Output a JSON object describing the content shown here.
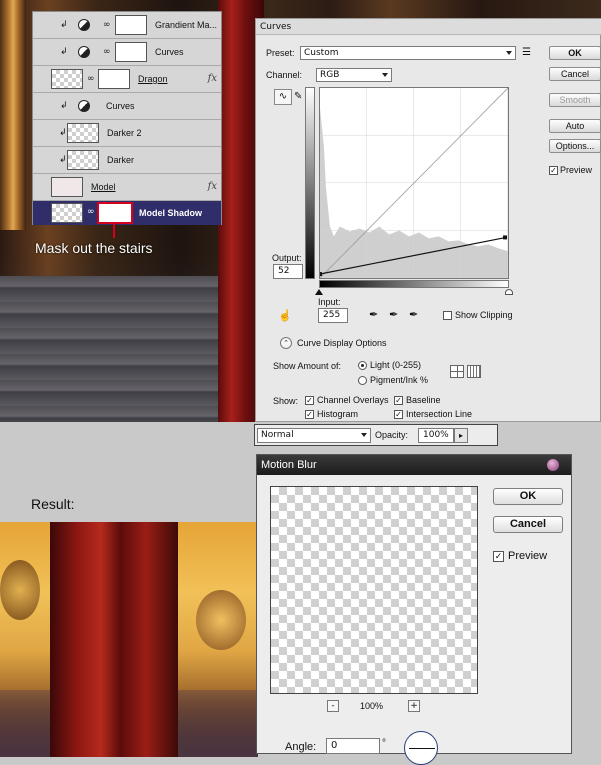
{
  "layers": [
    {
      "name": "Grandient Ma...",
      "kind": "adjustment",
      "selected": false,
      "fx": false
    },
    {
      "name": "Curves",
      "kind": "adjustment",
      "selected": false,
      "fx": false
    },
    {
      "name": "Dragon",
      "kind": "masked",
      "selected": false,
      "fx": true
    },
    {
      "name": "Curves",
      "kind": "adjustment-nomask",
      "selected": false,
      "fx": false
    },
    {
      "name": "Darker 2",
      "kind": "clip-pixel",
      "selected": false,
      "fx": false
    },
    {
      "name": "Darker",
      "kind": "clip-pixel",
      "selected": false,
      "fx": false
    },
    {
      "name": "Model",
      "kind": "pixel",
      "selected": false,
      "fx": true
    },
    {
      "name": "Model Shadow",
      "kind": "masked",
      "selected": true,
      "fx": false
    }
  ],
  "fx_glyph": "fx",
  "caption_mask": "Mask out the stairs",
  "caption_result": "Result:",
  "curves": {
    "title": "Curves",
    "preset_label": "Preset:",
    "preset_value": "Custom",
    "channel_label": "Channel:",
    "channel_value": "RGB",
    "output_label": "Output:",
    "output_value": "52",
    "input_label": "Input:",
    "input_value": "255",
    "show_clipping": "Show Clipping",
    "display_options": "Curve Display Options",
    "show_amount_label": "Show Amount of:",
    "light_option": "Light  (0-255)",
    "pigment_option": "Pigment/Ink %",
    "show_label": "Show:",
    "channel_overlays": "Channel Overlays",
    "baseline": "Baseline",
    "histogram": "Histogram",
    "intersection_line": "Intersection Line",
    "ok": "OK",
    "cancel": "Cancel",
    "smooth": "Smooth",
    "auto": "Auto",
    "options": "Options...",
    "preview": "Preview"
  },
  "blend": {
    "mode": "Normal",
    "opacity_label": "Opacity:",
    "opacity_value": "100%"
  },
  "motion_blur": {
    "title": "Motion Blur",
    "ok": "OK",
    "cancel": "Cancel",
    "preview": "Preview",
    "zoom": "100%",
    "zoom_out": "-",
    "zoom_in": "+",
    "angle_label": "Angle:",
    "angle_value": "0",
    "degree": "°"
  },
  "colors": {
    "selected_layer": "#2f2d6a",
    "mask_highlight": "#d6001c"
  }
}
